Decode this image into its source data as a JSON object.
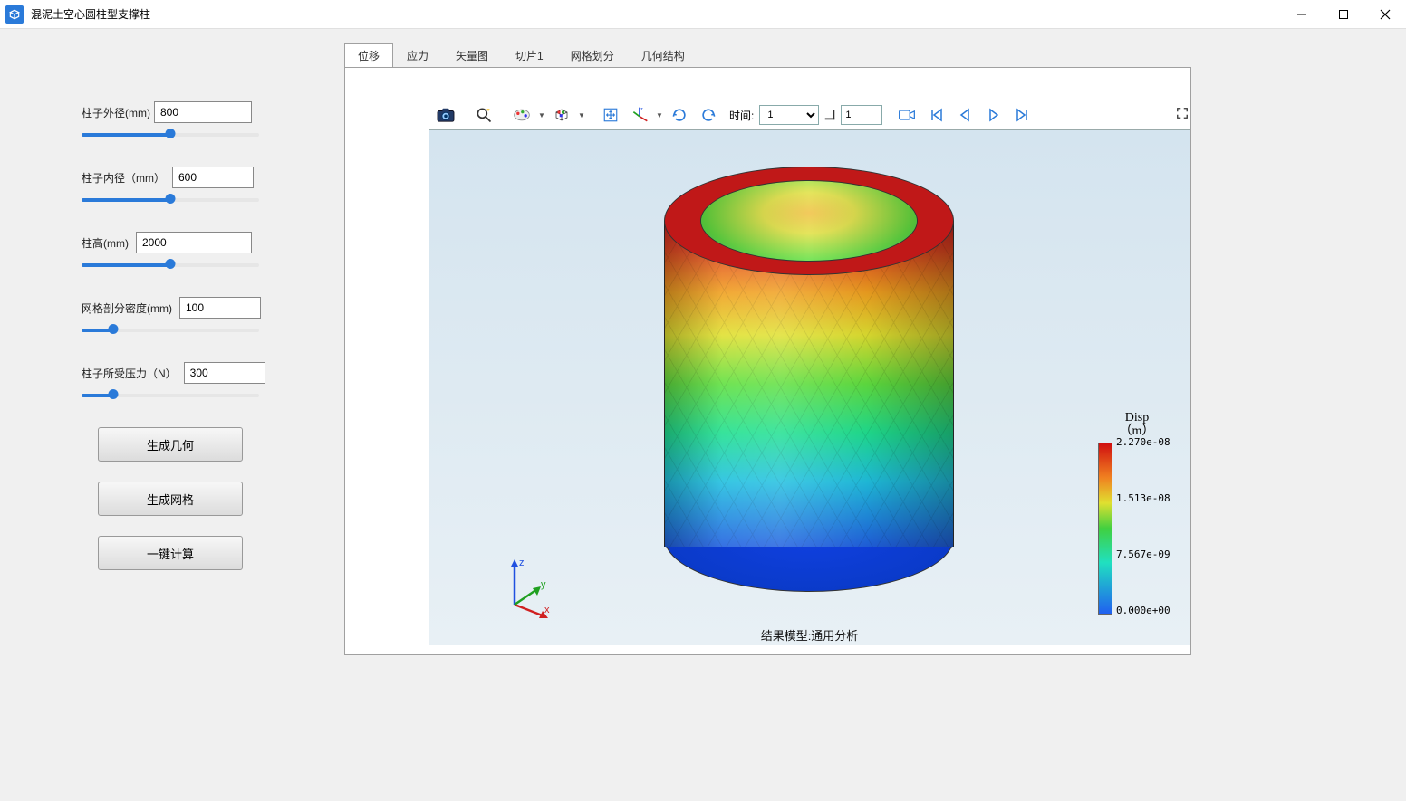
{
  "window": {
    "title": "混泥土空心圆柱型支撑柱"
  },
  "params": [
    {
      "label": "柱子外径(mm)",
      "value": "800",
      "pos": 50
    },
    {
      "label": "柱子内径（mm）",
      "value": "600",
      "pos": 50
    },
    {
      "label": "柱高(mm)",
      "value": "2000",
      "pos": 50
    },
    {
      "label": "网格剖分密度(mm)",
      "value": "100",
      "pos": 18
    },
    {
      "label": "柱子所受压力（N）",
      "value": "300",
      "pos": 18
    }
  ],
  "buttons": {
    "gen_geom": "生成几何",
    "gen_mesh": "生成网格",
    "compute": "一键计算"
  },
  "tabs": [
    "位移",
    "应力",
    "矢量图",
    "切片1",
    "网格划分",
    "几何结构"
  ],
  "active_tab": 0,
  "toolbar": {
    "time_label": "时间:",
    "time_value": "1",
    "spin_value": "1"
  },
  "caption": "结果模型:通用分析",
  "legend": {
    "title1": "Disp",
    "title2": "（m）",
    "ticks": [
      "2.270e-08",
      "1.513e-08",
      "7.567e-09",
      "0.000e+00"
    ]
  },
  "axis": {
    "x": "x",
    "y": "y",
    "z": "z"
  }
}
